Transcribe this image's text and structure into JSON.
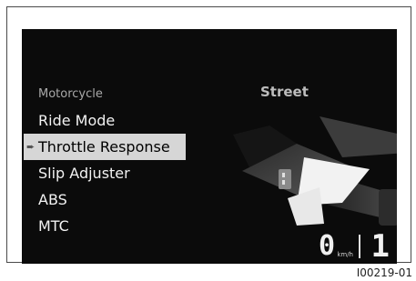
{
  "screen": {
    "category_label": "Motorcycle",
    "current_mode": "Street",
    "menu_items": [
      {
        "label": "Ride Mode",
        "selected": false
      },
      {
        "label": "Throttle Response",
        "selected": true
      },
      {
        "label": "Slip Adjuster",
        "selected": false
      },
      {
        "label": "ABS",
        "selected": false
      },
      {
        "label": "MTC",
        "selected": false
      }
    ],
    "speed": "0",
    "speed_unit": "km/h",
    "gear": "1"
  },
  "figure_id": "I00219-01"
}
